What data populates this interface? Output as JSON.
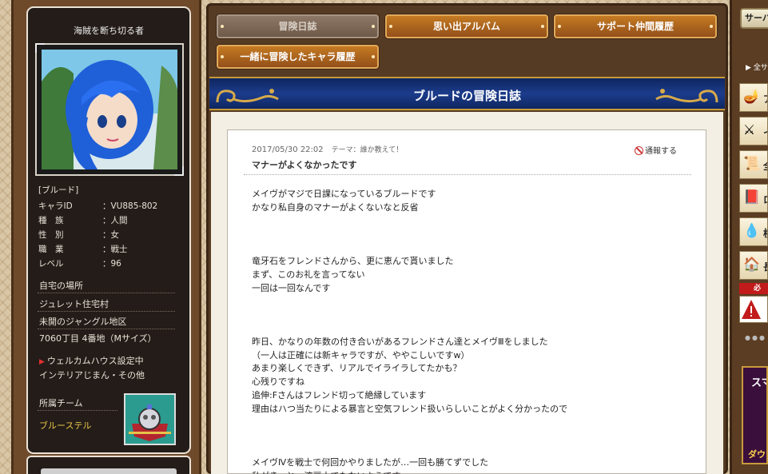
{
  "profile": {
    "title": "海賊を断ち切る者",
    "name": "[ブルード]",
    "rows": [
      {
        "label": "キャラID",
        "value": "：VU885-802"
      },
      {
        "label": "種　族",
        "value": "：人間"
      },
      {
        "label": "性　別",
        "value": "：女"
      },
      {
        "label": "職　業",
        "value": "：戦士"
      },
      {
        "label": "レベル",
        "value": "：96"
      }
    ],
    "home_label": "自宅の場所",
    "home_lines": [
      "ジュレット住宅村",
      "未開のジャングル地区",
      "7060丁目 4番地（Mサイズ）"
    ],
    "welcome": "ウェルカムハウス設定中",
    "interior": "インテリアじまん・その他",
    "team_label": "所属チーム",
    "team_name": "ブルーステル"
  },
  "tabs": {
    "journal": "冒険日誌",
    "album": "思い出アルバム",
    "support": "サポート仲間履歴",
    "companions": "一緒に冒険したキャラ履歴"
  },
  "header": {
    "title": "ブルードの冒険日誌"
  },
  "post": {
    "date": "2017/05/30 22:02",
    "theme": "テーマ：誰か教えて！",
    "report": "通報する",
    "title": "マナーがよくなかったです",
    "lines": [
      "メイヴがマジで日課になっているブルードです",
      "かなり私自身のマナーがよくないなと反省",
      "",
      "",
      "",
      "竜牙石をフレンドさんから、更に恵んで貰いました",
      "まず、このお礼を言ってない",
      "一回は一回なんです",
      "",
      "",
      "",
      "昨日、かなりの年数の付き合いがあるフレンドさん達とメイヴⅢをしました",
      "（一人は正確には新キャラですが、ややこしいですw）",
      "あまり楽しくできず、リアルでイライラしてたかも？",
      "心残りですね",
      "追伸:Fさんはフレンド切って絶縁しています",
      "理由はハつ当たりによる暴言と空気フレンド扱いらしいことがよく分かったので",
      "",
      "",
      "",
      "メイヴⅣを戦士で何回かやりましたが…一回も勝てずでした",
      "私がきっと一流戸士でもないようです"
    ]
  },
  "sidebar": {
    "server_label": "サーバー",
    "all_label": "全サ",
    "items": [
      {
        "icon": "lamp-icon",
        "text": "ア"
      },
      {
        "icon": "sword-icon",
        "text": "イ"
      },
      {
        "icon": "scroll-icon",
        "text": "全"
      },
      {
        "icon": "book-icon",
        "text": "ロ"
      },
      {
        "icon": "slime-icon",
        "text": "横"
      },
      {
        "icon": "house-icon",
        "text": "長"
      }
    ],
    "must_label": "必",
    "banner_text": "スマ",
    "banner_text2": "ダウ"
  },
  "colors": {
    "tab_orange": "#c57a22",
    "tab_active": "#8d7766",
    "header_blue": "#1c3c8c",
    "team_name": "#e6c34a",
    "report_red": "#cc3333"
  }
}
